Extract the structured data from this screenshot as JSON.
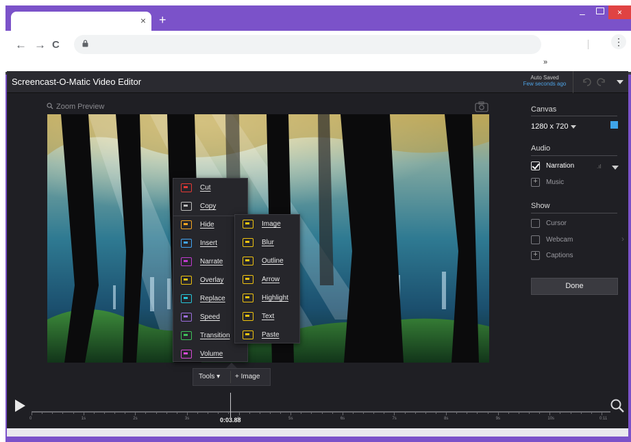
{
  "browser": {
    "tab_close": "×",
    "new_tab": "+",
    "win_min": "–",
    "win_close": "×",
    "nav_back": "←",
    "nav_forward": "→",
    "nav_reload": "C",
    "menu_dots": "⋮",
    "bookmarks_more": "»"
  },
  "editor": {
    "title": "Screencast-O-Matic Video Editor",
    "autosave_line1": "Auto Saved",
    "autosave_line2": "Few seconds ago",
    "zoom_preview": "Zoom Preview"
  },
  "context_menu": {
    "primary": [
      {
        "label": "Cut",
        "color": "#e53935"
      },
      {
        "label": "Copy",
        "color": "#bdbdbd"
      },
      {
        "label": "Hide",
        "color": "#f5a623"
      },
      {
        "label": "Insert",
        "color": "#42a5f5"
      },
      {
        "label": "Narrate",
        "color": "#c13bd1"
      },
      {
        "label": "Overlay",
        "color": "#f1c40f"
      },
      {
        "label": "Replace",
        "color": "#26c6da"
      },
      {
        "label": "Speed",
        "color": "#9c6ede"
      },
      {
        "label": "Transition",
        "color": "#3ec25a"
      },
      {
        "label": "Volume",
        "color": "#d94ad8"
      }
    ],
    "overlay_submenu": [
      {
        "label": "Image",
        "color": "#f1c40f"
      },
      {
        "label": "Blur",
        "color": "#f1c40f"
      },
      {
        "label": "Outline",
        "color": "#f1c40f"
      },
      {
        "label": "Arrow",
        "color": "#f1c40f"
      },
      {
        "label": "Highlight",
        "color": "#f1c40f"
      },
      {
        "label": "Text",
        "color": "#f1c40f"
      },
      {
        "label": "Paste",
        "color": "#f1c40f"
      }
    ]
  },
  "tools_bar": {
    "tools_label": "Tools ▾",
    "image_label": "+ Image"
  },
  "panel": {
    "canvas_heading": "Canvas",
    "canvas_size": "1280 x 720",
    "canvas_color": "#3fa4e8",
    "audio_heading": "Audio",
    "narration": "Narration",
    "music": "Music",
    "show_heading": "Show",
    "cursor": "Cursor",
    "webcam": "Webcam",
    "captions": "Captions",
    "done": "Done"
  },
  "timeline": {
    "current_time": "0:03.88",
    "ticks": [
      "0",
      "1s",
      "2s",
      "3s",
      "4s",
      "5s",
      "6s",
      "7s",
      "8s",
      "9s",
      "10s",
      "0:11"
    ]
  },
  "colors": {
    "browser_accent": "#7b52c9",
    "editor_bg": "#1f1f24",
    "highlight_blue": "#4ea3e6"
  }
}
